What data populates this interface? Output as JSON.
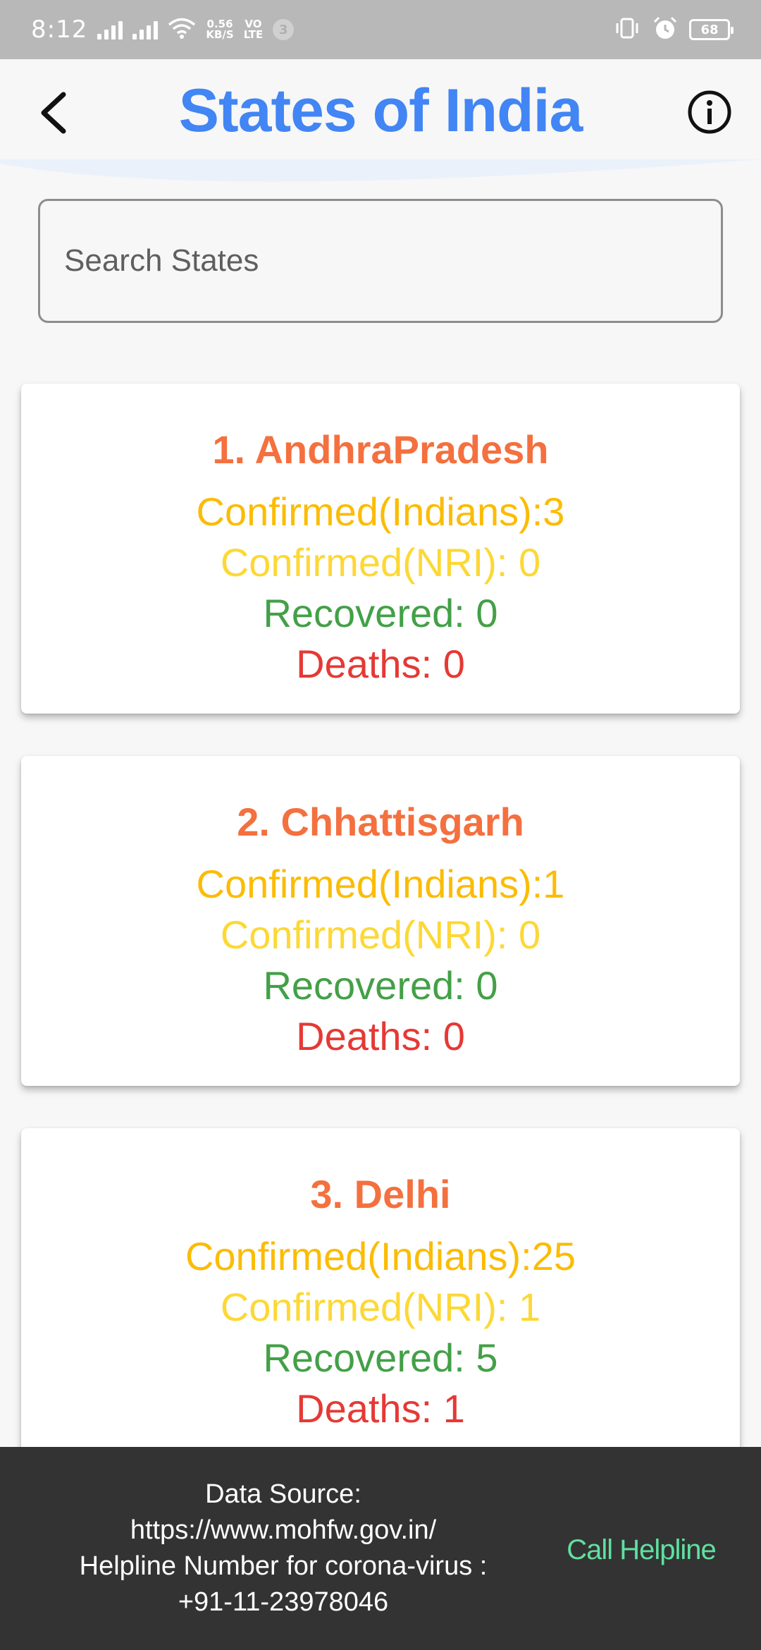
{
  "status_bar": {
    "time": "8:12",
    "speed": "0.56",
    "speed_unit": "KB/S",
    "volte_top": "VO",
    "volte_bottom": "LTE",
    "notif_count": "3",
    "battery": "68"
  },
  "header": {
    "title": "States of India",
    "back_icon": "back-arrow-icon",
    "info_icon": "info-icon"
  },
  "search": {
    "placeholder": "Search States",
    "value": ""
  },
  "states": [
    {
      "title": "1.  AndhraPradesh",
      "confirmed_indians": "Confirmed(Indians):3",
      "confirmed_nri": "Confirmed(NRI): 0",
      "recovered": "Recovered: 0",
      "deaths": "Deaths: 0"
    },
    {
      "title": "2.  Chhattisgarh",
      "confirmed_indians": "Confirmed(Indians):1",
      "confirmed_nri": "Confirmed(NRI): 0",
      "recovered": "Recovered: 0",
      "deaths": "Deaths: 0"
    },
    {
      "title": "3.  Delhi",
      "confirmed_indians": "Confirmed(Indians):25",
      "confirmed_nri": "Confirmed(NRI): 1",
      "recovered": "Recovered: 5",
      "deaths": "Deaths: 1"
    }
  ],
  "footer": {
    "line1": "Data Source:",
    "line2": "https://www.mohfw.gov.in/",
    "line3": "Helpline Number for corona-virus :",
    "line4": "+91-11-23978046",
    "helpline_button": "Call Helpline"
  },
  "colors": {
    "title_blue": "#4285f4",
    "state_orange": "#f4703f",
    "confirmed": "#fbbc05",
    "nri": "#fdd835",
    "recovered": "#43a047",
    "deaths": "#e53935",
    "helpline": "#5fe0a0"
  }
}
